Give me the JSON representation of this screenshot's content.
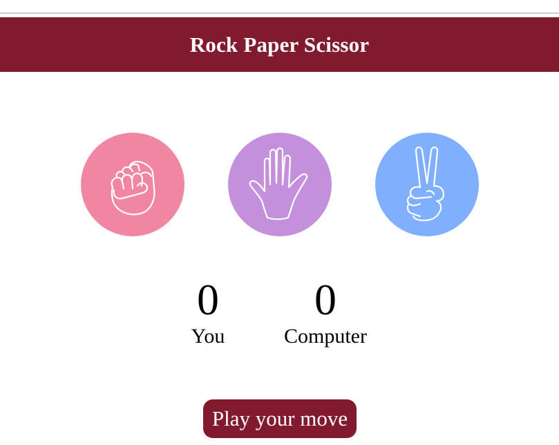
{
  "header": {
    "title": "Rock Paper Scissor",
    "color": "#811a2f"
  },
  "choices": [
    {
      "id": "rock",
      "icon": "rock-fist-icon",
      "color": "#f186a2"
    },
    {
      "id": "paper",
      "icon": "paper-hand-icon",
      "color": "#c490dc"
    },
    {
      "id": "scissor",
      "icon": "scissor-hand-icon",
      "color": "#80b0fd"
    }
  ],
  "scoreboard": {
    "user": {
      "score": "0",
      "label": "You"
    },
    "computer": {
      "score": "0",
      "label": "Computer"
    }
  },
  "message": {
    "text": "Play your move",
    "color": "#811a2f"
  }
}
